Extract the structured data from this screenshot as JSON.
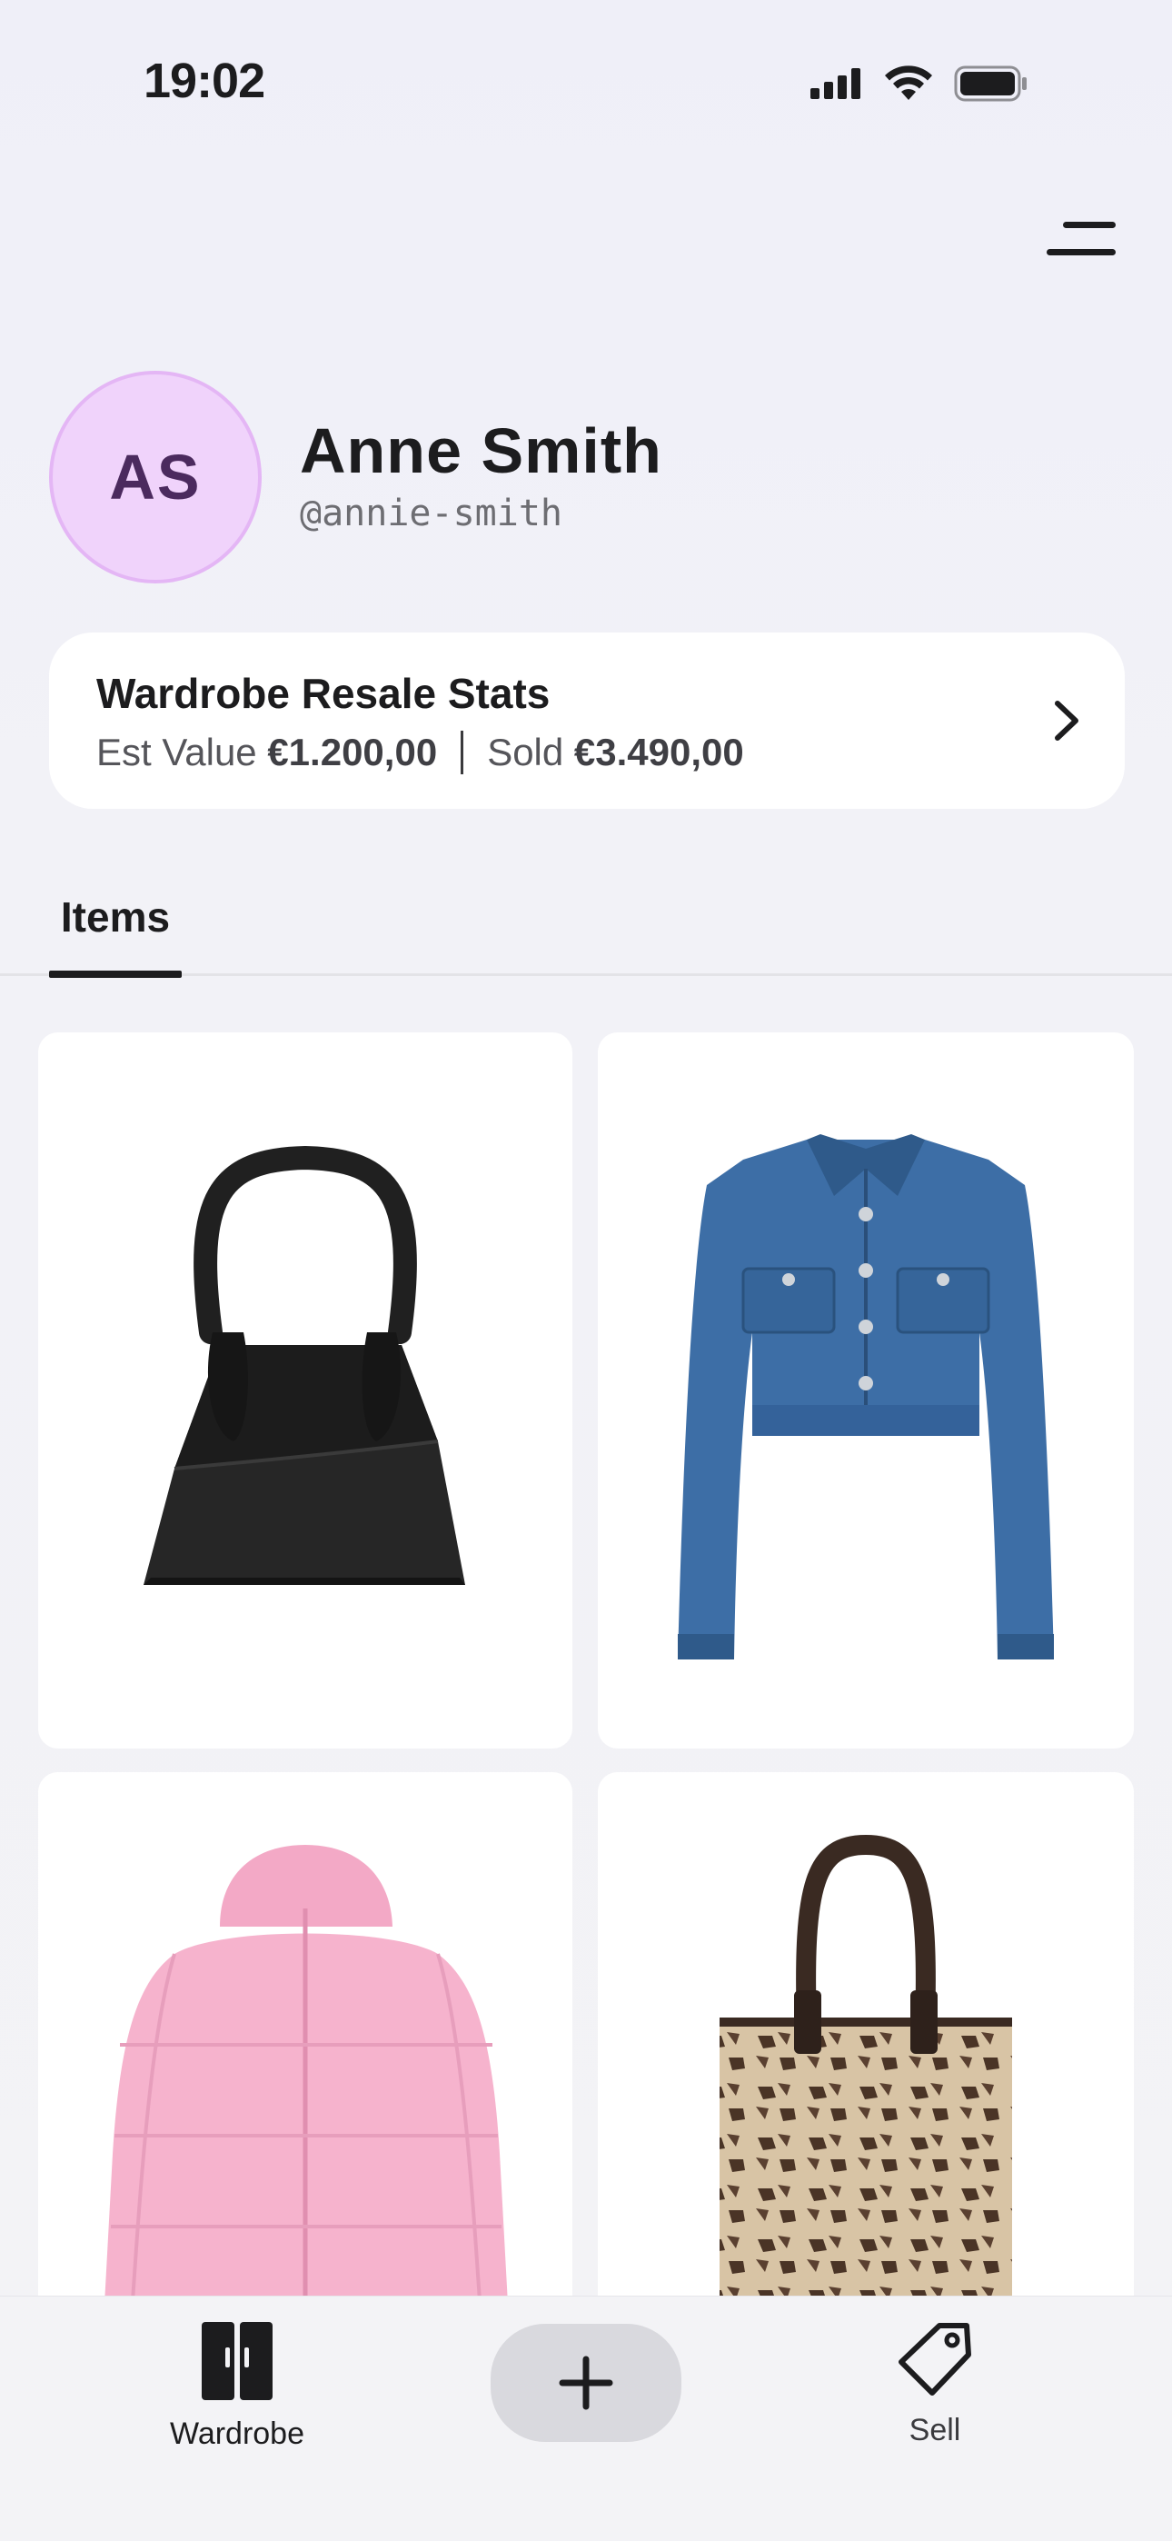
{
  "status_bar": {
    "time": "19:02",
    "icons": [
      "cellular-signal-icon",
      "wifi-icon",
      "battery-icon"
    ]
  },
  "header": {
    "menu_icon": "hamburger-menu-icon"
  },
  "profile": {
    "initials": "AS",
    "name": "Anne Smith",
    "handle": "@annie-smith",
    "avatar_color": "#f0d3fb"
  },
  "stats": {
    "title": "Wardrobe Resale Stats",
    "est_label": "Est Value",
    "est_value": "€1.200,00",
    "sold_label": "Sold",
    "sold_value": "€3.490,00"
  },
  "tabs": [
    {
      "label": "Items",
      "active": true
    }
  ],
  "items": [
    {
      "name": "black-handbag",
      "kind": "bag"
    },
    {
      "name": "denim-cropped-jacket",
      "kind": "jacket"
    },
    {
      "name": "pink-puffer-jacket",
      "kind": "puffer"
    },
    {
      "name": "monogram-tote-bag",
      "kind": "tote"
    }
  ],
  "tab_bar": {
    "wardrobe_label": "Wardrobe",
    "sell_label": "Sell",
    "add_icon": "plus-icon"
  }
}
